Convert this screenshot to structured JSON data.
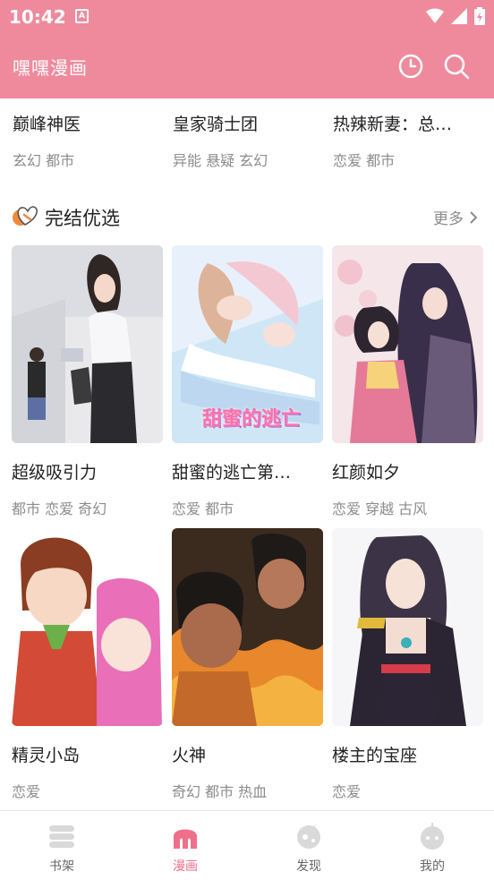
{
  "status": {
    "time": "10:42",
    "notification_glyph": "A"
  },
  "app_bar": {
    "title": "嘿嘿漫画",
    "actions": [
      "history-icon",
      "search-icon"
    ],
    "color": "#ef8a9d"
  },
  "top_row": [
    {
      "title": "巅峰神医",
      "genres": "玄幻 都市"
    },
    {
      "title": "皇家骑士团",
      "genres": "异能 悬疑 玄幻"
    },
    {
      "title": "热辣新妻：总…",
      "genres": "恋爱 都市"
    }
  ],
  "section": {
    "title": "完结优选",
    "more_label": "更多",
    "icon": "heart-badge-icon"
  },
  "comics": [
    {
      "title": "超级吸引力",
      "genres": "都市 恋爱 奇幻",
      "cover_text": ""
    },
    {
      "title": "甜蜜的逃亡第…",
      "genres": "恋爱 都市",
      "cover_text": "甜蜜的逃亡"
    },
    {
      "title": "红颜如夕",
      "genres": "恋爱 穿越 古风",
      "cover_text": ""
    },
    {
      "title": "精灵小岛",
      "genres": "恋爱",
      "cover_text": ""
    },
    {
      "title": "火神",
      "genres": "奇幻 都市 热血",
      "cover_text": ""
    },
    {
      "title": "楼主的宝座",
      "genres": "恋爱",
      "cover_text": ""
    }
  ],
  "bottom_nav": [
    {
      "label": "书架",
      "icon": "bookshelf-icon",
      "active": false
    },
    {
      "label": "漫画",
      "icon": "comic-icon",
      "active": true
    },
    {
      "label": "发现",
      "icon": "discover-icon",
      "active": false
    },
    {
      "label": "我的",
      "icon": "profile-icon",
      "active": false
    }
  ],
  "colors": {
    "accent": "#ef8a9d",
    "active_tab": "#ef6f8a",
    "secondary_text": "#8c8c8c"
  }
}
